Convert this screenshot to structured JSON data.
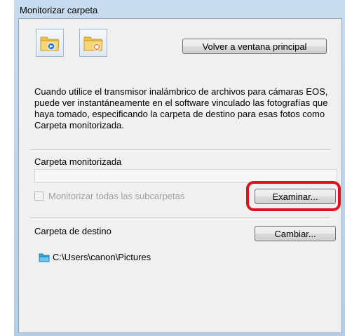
{
  "window": {
    "title": "Monitorizar carpeta"
  },
  "toolbar": {
    "monitor_icon": "folder-monitor-icon",
    "stop_icon": "folder-stop-icon",
    "back_label": "Volver a ventana principal"
  },
  "description": "Cuando utilice el transmisor inalámbrico de archivos para cámaras EOS, puede ver instantáneamente en el software vinculado las fotografías que haya tomado, especificando la carpeta de destino para esas fotos como Carpeta monitorizada.",
  "monitored": {
    "label": "Carpeta monitorizada",
    "path_value": "",
    "subfolders_label": "Monitorizar todas las subcarpetas",
    "subfolders_checked": false,
    "browse_label": "Examinar..."
  },
  "destination": {
    "label": "Carpeta de destino",
    "change_label": "Cambiar...",
    "path": "C:\\Users\\canon\\Pictures"
  },
  "colors": {
    "highlight": "#e0101d",
    "folder": "#f0c24b",
    "dest_folder": "#3ba7dc"
  }
}
